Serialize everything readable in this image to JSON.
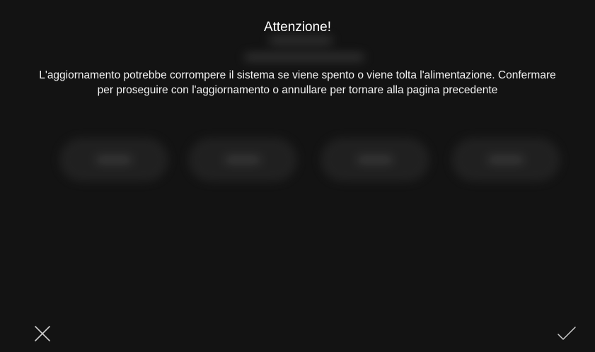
{
  "dialog": {
    "title": "Attenzione!",
    "message_line1": "L'aggiornamento potrebbe corrompere il sistema se viene spento o viene tolta l'alimentazione. Confermare",
    "message_line2": "per proseguire con l'aggiornamento o annullare per tornare alla pagina precedente"
  },
  "actions": {
    "cancel_icon": "close-icon",
    "confirm_icon": "check-icon"
  },
  "colors": {
    "background": "#131313",
    "text": "#ffffff",
    "icon": "#cfcfcf"
  }
}
